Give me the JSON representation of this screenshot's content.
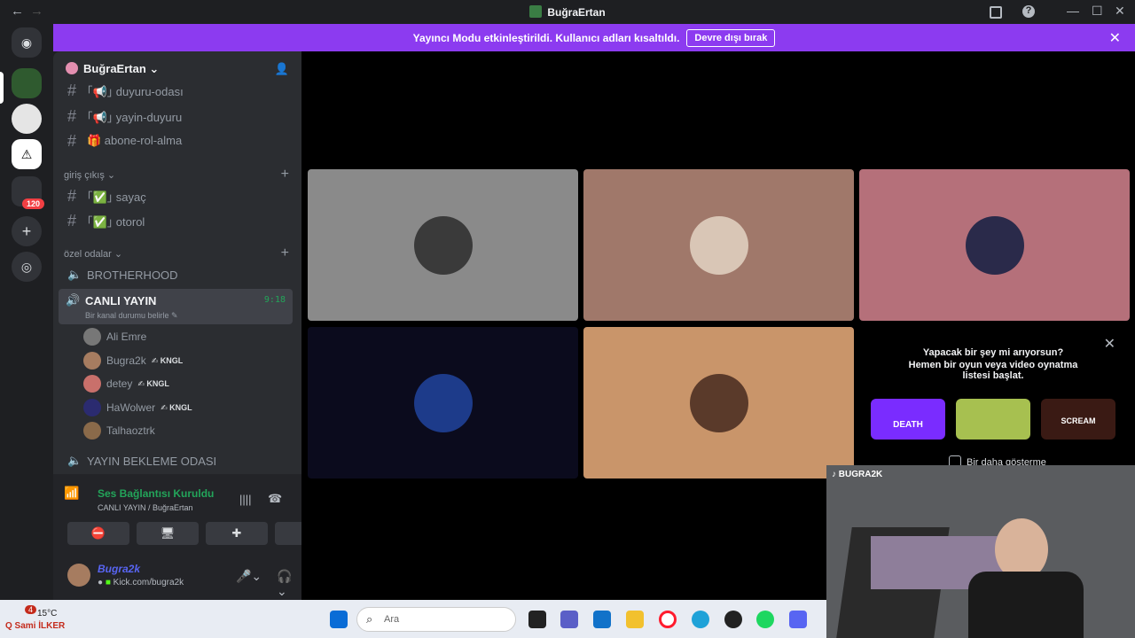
{
  "titlebar": {
    "title": "BuğraErtan",
    "back": "←",
    "forward": "→",
    "inbox_icon": "inbox-icon",
    "help": "?",
    "min": "—",
    "max": "☐",
    "close": "✕"
  },
  "rail": {
    "badge_count": "120"
  },
  "banner": {
    "text": "Yayıncı Modu etkinleştirildi. Kullanıcı adları kısaltıldı.",
    "button": "Devre dışı bırak",
    "close": "✕"
  },
  "server": {
    "name": "BuğraErtan"
  },
  "channels": [
    {
      "icon": "#",
      "label": "｢📢｣ duyuru-odası"
    },
    {
      "icon": "#",
      "label": "｢📢｣ yayin-duyuru"
    },
    {
      "icon": "#",
      "label": "🎁 abone-rol-alma"
    }
  ],
  "categories": {
    "giris": {
      "label": "giriş çıkış ⌄",
      "channels": [
        "｢✅｣ sayaç",
        "｢✅｣ otorol"
      ]
    },
    "ozel": {
      "label": "özel odalar ⌄"
    }
  },
  "voice_channels": {
    "brotherhood": "BROTHERHOOD",
    "canli": {
      "name": "CANLI YAYIN",
      "time": "9:18",
      "status": "Bir kanal durumu belirle ✎"
    },
    "bekleme": "YAYIN BEKLEME ODASI"
  },
  "members": [
    {
      "name": "Ali Emre",
      "tag": "",
      "color": "#777"
    },
    {
      "name": "Bugra2k",
      "tag": "✍ KNGL",
      "color": "#a67c60"
    },
    {
      "name": "detey",
      "tag": "✍ KNGL",
      "color": "#c9706b"
    },
    {
      "name": "HaWolwer",
      "tag": "✍ KNGL",
      "color": "#2b2b70"
    },
    {
      "name": "Talhaoztrk",
      "tag": "",
      "color": "#8a6a4a"
    }
  ],
  "voice_panel": {
    "status": "Ses Bağlantısı Kuruldu",
    "location": "CANLI YAYIN / BuğraErtan"
  },
  "user": {
    "name": "Bugra2k",
    "status": "Kick.com/bugra2k"
  },
  "tiles": [
    {
      "color": "#8a8a8a",
      "avatar": "#3a3a3a"
    },
    {
      "color": "#a0786a",
      "avatar": "#d9c6b6"
    },
    {
      "color": "#b5707a",
      "avatar": "#2a2a4a"
    },
    {
      "color": "#0b0b1d",
      "avatar": "#1d3b8a"
    },
    {
      "color": "#c9956a",
      "avatar": "#5a3a2a"
    }
  ],
  "promo": {
    "line1": "Yapacak bir şey mi arıyorsun?",
    "line2": "Hemen bir oyun veya video oynatma listesi başlat.",
    "dont_show": "Bir daha gösterme",
    "games": [
      "DEATH",
      "",
      "SCREAM"
    ]
  },
  "cam": {
    "handle": "BUGRA2K"
  },
  "taskbar": {
    "weather_badge": "4",
    "weather_temp": "15°C",
    "weather_label": "Q Sami İLKER",
    "search_placeholder": "Ara"
  }
}
